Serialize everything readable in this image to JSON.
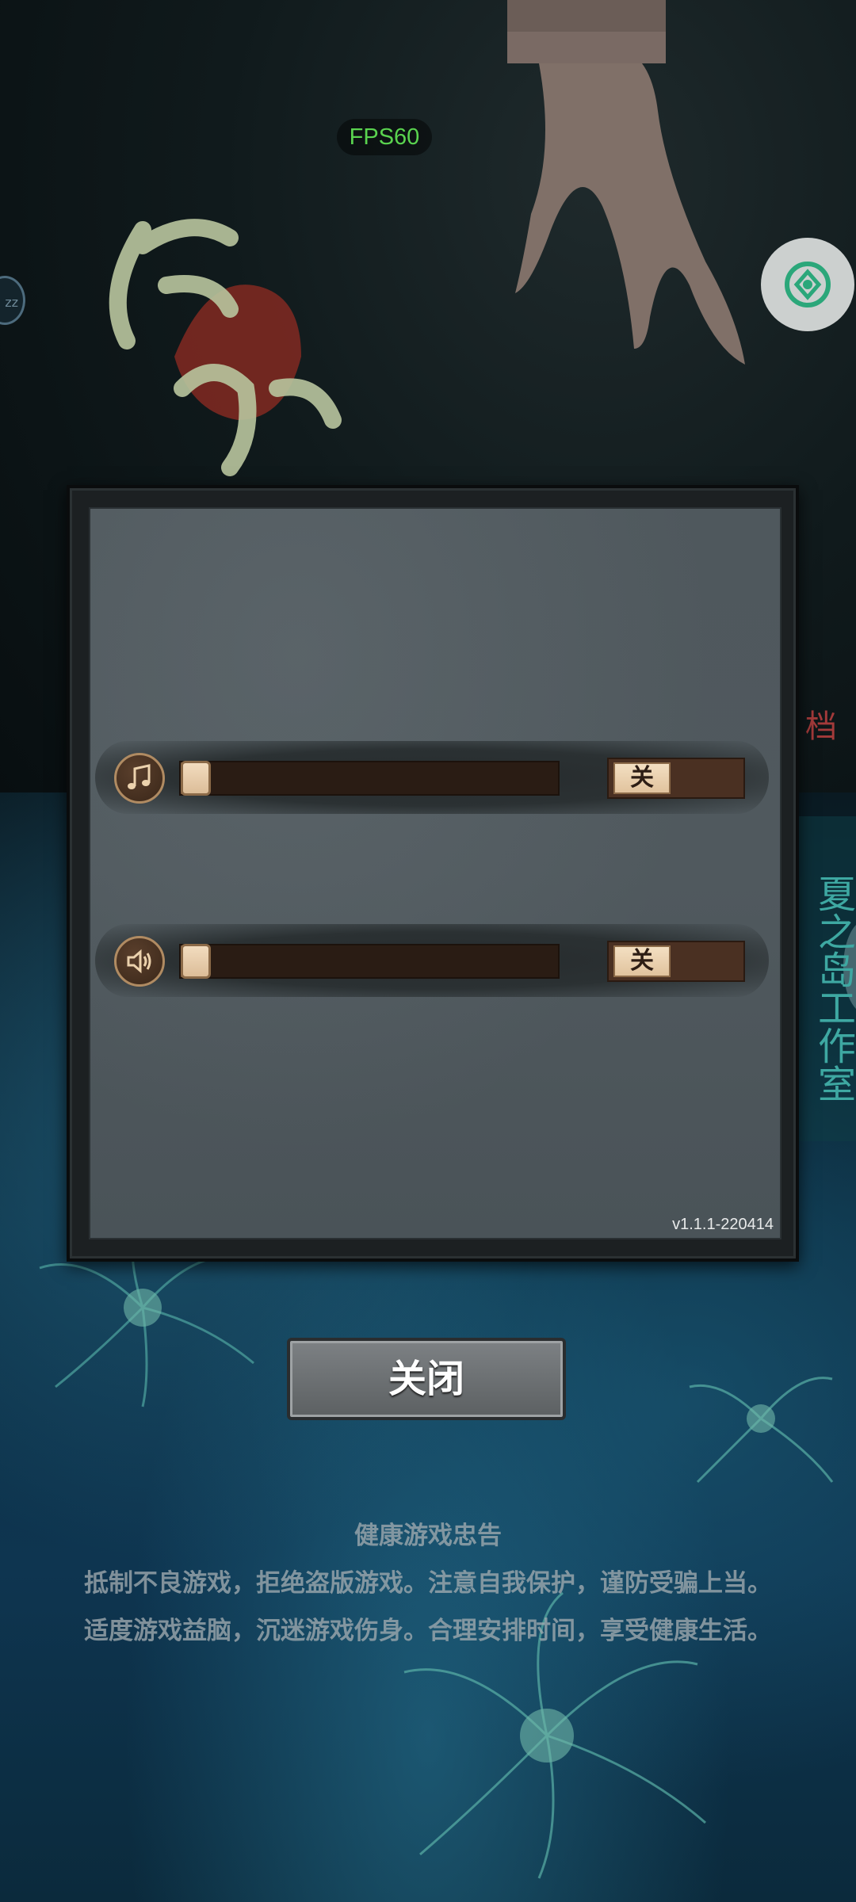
{
  "hud": {
    "fps": "FPS60",
    "left_badge": "zz"
  },
  "side": {
    "red_char": "档",
    "studio_tag": "夏之岛工作室"
  },
  "settings": {
    "music": {
      "icon": "music-note-icon",
      "volume": 0.0,
      "toggle_label": "关"
    },
    "sound": {
      "icon": "speaker-icon",
      "volume": 0.0,
      "toggle_label": "关"
    },
    "version": "v1.1.1-220414"
  },
  "close_button": {
    "label": "关闭"
  },
  "health_notice": {
    "title": "健康游戏忠告",
    "line1": "抵制不良游戏，拒绝盗版游戏。注意自我保护，谨防受骗上当。",
    "line2": "适度游戏益脑，沉迷游戏伤身。合理安排时间，享受健康生活。"
  },
  "colors": {
    "fps_green": "#5ad34f",
    "studio_teal": "#3ea8a2",
    "slider_knob": "#e6c9a5"
  }
}
